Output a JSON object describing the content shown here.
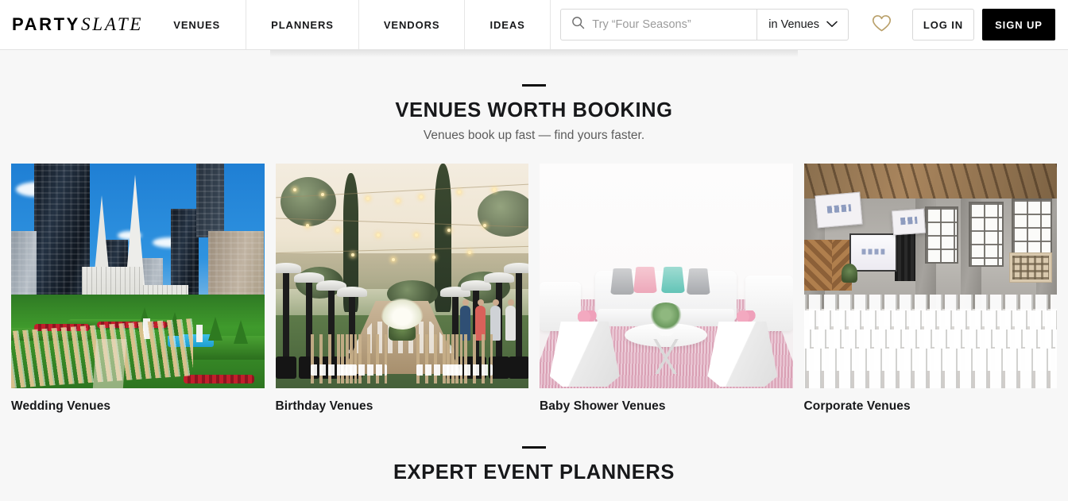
{
  "brand": {
    "name_bold": "PARTY",
    "name_italic": "SLATE"
  },
  "nav": {
    "items": [
      {
        "label": "VENUES"
      },
      {
        "label": "PLANNERS"
      },
      {
        "label": "VENDORS"
      },
      {
        "label": "IDEAS"
      }
    ]
  },
  "search": {
    "placeholder": "Try “Four Seasons”",
    "value": "",
    "scope_label": "in Venues",
    "search_icon": "search-icon",
    "chevron_icon": "chevron-down-icon"
  },
  "header_actions": {
    "favorites_icon": "heart-icon",
    "favorites_color": "#b9a06a",
    "login_label": "LOG IN",
    "signup_label": "SIGN UP",
    "signup_bg": "#000000"
  },
  "sections": [
    {
      "title": "VENUES WORTH BOOKING",
      "subtitle": "Venues book up fast — find yours faster.",
      "cards": [
        {
          "label": "Wedding Venues",
          "scene": "wedding-rooftop-cathedral"
        },
        {
          "label": "Birthday Venues",
          "scene": "outdoor-banquet-dusk"
        },
        {
          "label": "Baby Shower Venues",
          "scene": "white-lounge-pastel"
        },
        {
          "label": "Corporate Venues",
          "scene": "industrial-loft-seating"
        }
      ]
    },
    {
      "title": "EXPERT EVENT PLANNERS",
      "subtitle": ""
    }
  ],
  "theme": {
    "page_bg": "#f7f7f7",
    "header_bg": "#ffffff",
    "text": "#17181a",
    "muted": "#5c5c5c",
    "border": "#d8d8d8"
  }
}
